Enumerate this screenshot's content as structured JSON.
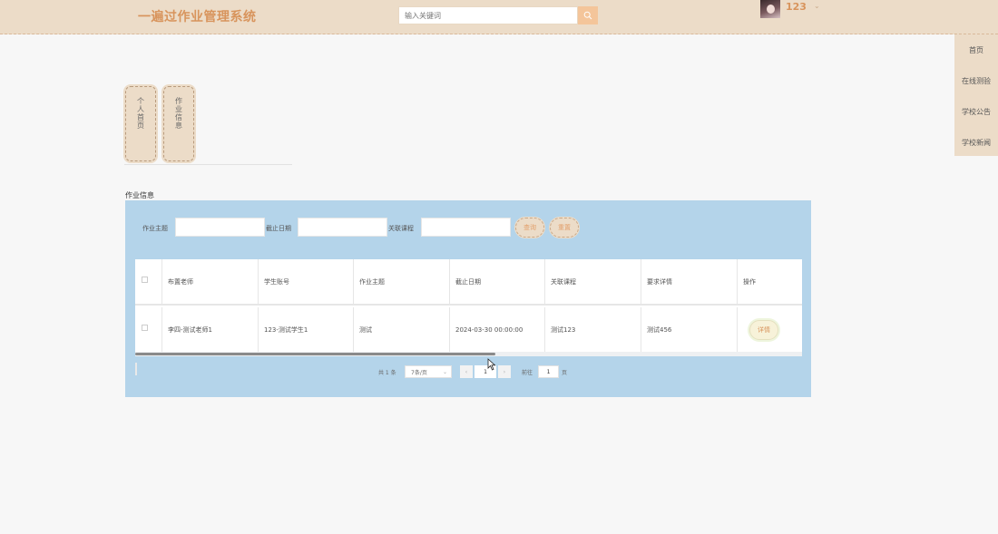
{
  "header": {
    "title": "一遍过作业管理系统",
    "search_placeholder": "输入关键词",
    "username": "123",
    "user_caret": "⌄"
  },
  "nav": {
    "items": [
      "首页",
      "在线测验",
      "学校公告",
      "学校新闻"
    ]
  },
  "side_tabs": [
    {
      "label": "个人首页"
    },
    {
      "label": "作业信息"
    }
  ],
  "section_title": "作业信息",
  "filters": {
    "topic_label": "作业主题",
    "deadline_label": "截止日期",
    "course_label": "关联课程",
    "search_button": "查询",
    "reset_button": "重置"
  },
  "table": {
    "columns": [
      "布置老师",
      "学生账号",
      "作业主题",
      "截止日期",
      "关联课程",
      "要求详情",
      "操作"
    ],
    "rows": [
      {
        "teacher": "李四-测试老师1",
        "student": "123-测试学生1",
        "topic": "测试",
        "deadline": "2024-03-30 00:00:00",
        "course": "测试123",
        "detail": "测试456",
        "action": "详情"
      }
    ]
  },
  "pagination": {
    "total": "共 1 条",
    "page_size": "7条/页",
    "current_page": "1",
    "goto_label": "前往",
    "goto_value": "1",
    "page_suffix": "页",
    "prev": "‹",
    "next": "›"
  },
  "colors": {
    "header_bg": "#ecdcc8",
    "accent": "#d8945c",
    "panel_bg": "#b4d4ea"
  }
}
